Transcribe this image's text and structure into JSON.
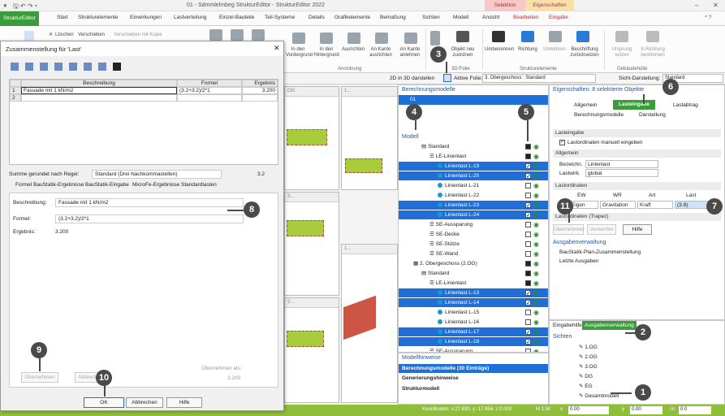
{
  "app": {
    "title": "01 - Sdmmlelmbeg StrukturEditor - StrukturEditor 2022",
    "context_selection": "Selektion",
    "context_properties": "Eigenschaften"
  },
  "tabs": [
    "StrukturEditor",
    "Start",
    "Strukturelemente",
    "Einwirkungen",
    "Lastverteilung",
    "Einzel-Bauteile",
    "Teil-Systeme",
    "Details",
    "Grafikelemente",
    "Bemaßung",
    "Sichten",
    "Modell",
    "Ansicht",
    "Bearbeiten",
    "Eingabe"
  ],
  "ribbon": {
    "loeschen": "Löschen",
    "verschieben": "Verschieben",
    "verschieben_kopie": "Verschieben mit Kopie",
    "in_den_vordergrund": "In den Vordergrund",
    "in_den_hintergrund": "In den Hintergrund",
    "ausrichten": "Ausrichten",
    "an_kante_ausrichten": "An Kante ausrichten",
    "an_kante_anlehnen": "An Kante anlehnen",
    "objekt_neu_zuordnen": "Objekt neu zuordnen",
    "umbenennen": "Umbenennen",
    "richtung": "Richtung",
    "umkehren": "Umkehren",
    "beschriftung_zurucksetzen": "Beschriftung zurücksetzen",
    "ursprung_setzen": "Ursprung setzen",
    "x_richtung_bestimmen": "X-Richtung bestimmen",
    "group_anordnung": "Anordnung",
    "group_3dfolie": "3D-Folie",
    "group_strukturelemente": "Strukturelemente",
    "group_gebaeudehuelle": "Gebäudehülle"
  },
  "optbar": {
    "label_2d3d": "2D in 3D darstellen",
    "label_aktive_folie": "Aktive Folie:",
    "aktive_folie": "3. Obergeschoss : Standard",
    "label_sicht": "Sicht-Darstellung:",
    "sicht": "Standard"
  },
  "views": {
    "v1": "OG",
    "v2": "1...",
    "v3": "3...",
    "v4": "1...",
    "v5": "3..."
  },
  "berechnungsmodelle": {
    "header": "Berechnungsmodelle",
    "item": "01",
    "modell_label": "Modell",
    "rows": [
      {
        "label": "Standard",
        "level": 2,
        "icon": "folder",
        "sel": false,
        "ck": "box"
      },
      {
        "label": "LE-Linienlast",
        "level": 3,
        "icon": "list",
        "sel": false,
        "ck": "box"
      },
      {
        "label": "Linienlast L-19",
        "level": 4,
        "icon": "dot",
        "sel": true,
        "ck": "on"
      },
      {
        "label": "Linienlast L-20",
        "level": 4,
        "icon": "dot",
        "sel": true,
        "ck": "on"
      },
      {
        "label": "Linienlast L-21",
        "level": 4,
        "icon": "dot",
        "sel": false,
        "ck": "off"
      },
      {
        "label": "Linienlast L-22",
        "level": 4,
        "icon": "dot",
        "sel": false,
        "ck": "off"
      },
      {
        "label": "Linienlast L-23",
        "level": 4,
        "icon": "dot",
        "sel": true,
        "ck": "on"
      },
      {
        "label": "Linienlast L-24",
        "level": 4,
        "icon": "dot",
        "sel": true,
        "ck": "on"
      },
      {
        "label": "SE-Aussparung",
        "level": 3,
        "icon": "list",
        "sel": false,
        "ck": "off"
      },
      {
        "label": "SE-Decke",
        "level": 3,
        "icon": "list",
        "sel": false,
        "ck": "off"
      },
      {
        "label": "SE-Stütze",
        "level": 3,
        "icon": "list",
        "sel": false,
        "ck": "off"
      },
      {
        "label": "SE-Wand",
        "level": 3,
        "icon": "list",
        "sel": false,
        "ck": "off"
      },
      {
        "label": "2. Obergeschoss (2.OG)",
        "level": 1,
        "icon": "floor",
        "sel": false,
        "ck": "box"
      },
      {
        "label": "Standard",
        "level": 2,
        "icon": "folder",
        "sel": false,
        "ck": "box"
      },
      {
        "label": "LE-Linienlast",
        "level": 3,
        "icon": "list",
        "sel": false,
        "ck": "box"
      },
      {
        "label": "Linienlast L-13",
        "level": 4,
        "icon": "dot",
        "sel": true,
        "ck": "on"
      },
      {
        "label": "Linienlast L-14",
        "level": 4,
        "icon": "dot",
        "sel": true,
        "ck": "on"
      },
      {
        "label": "Linienlast L-15",
        "level": 4,
        "icon": "dot",
        "sel": false,
        "ck": "off"
      },
      {
        "label": "Linienlast L-16",
        "level": 4,
        "icon": "dot",
        "sel": false,
        "ck": "off"
      },
      {
        "label": "Linienlast L-17",
        "level": 4,
        "icon": "dot",
        "sel": true,
        "ck": "on"
      },
      {
        "label": "Linienlast L-18",
        "level": 4,
        "icon": "dot",
        "sel": true,
        "ck": "on"
      },
      {
        "label": "SE-Aussparung",
        "level": 3,
        "icon": "list",
        "sel": false,
        "ck": "off"
      }
    ]
  },
  "hinweise": {
    "header": "Modellhinweise",
    "row1": "Berechnungsmodelle (30 Einträge)",
    "row2": "Generierungshinweise",
    "row3": "Strukturmodell"
  },
  "properties": {
    "header": "Eigenschaften: 8 selektierte Objekte",
    "tab_allgemein": "Allgemein",
    "tab_lasteingabe": "Lasteingabe",
    "tab_lastabtrag": "Lastabtrag",
    "tab_berechnungsmodelle": "Berechnungsmodelle",
    "tab_darstellung": "Darstellung",
    "sect_lasteingabe": "Lasteingabe",
    "chk_manuell": "Lastordinaten manuell eingeben",
    "sect_allgemein": "Allgemein",
    "lbl_bezeichn": "Bezeichn.",
    "val_bezeichn": "Linienlast",
    "lbl_lastwirk": "Lastwirk.",
    "val_lastwirk": "global",
    "sect_lastordinaten": "Lastordinaten",
    "col_ew": "EW",
    "col_wr": "WR",
    "col_art": "Art",
    "col_last": "Last",
    "val_ew": "Eigen",
    "val_wr": "Gravitation",
    "val_art": "Kraft",
    "val_last": "(3.8)",
    "sect_trapez": "Lastordinaten (Trapez)",
    "btn_uebernehmen": "Übernehmen",
    "btn_verwerfen": "Verwerfen",
    "btn_hilfe": "Hilfe"
  },
  "ausgaben": {
    "header": "Ausgabenverwaltung",
    "item1": "BauStatik-Plan-Zusammenstellung",
    "item2": "Letzte Ausgaben"
  },
  "sichten": {
    "tab_eingabehilfe": "Eingabehilfe",
    "tab_ausgaben": "Ausgabenverwaltung",
    "header": "Sichten",
    "items": [
      "1.OG",
      "2.OG",
      "3.OG",
      "DG",
      "EG",
      "Gesamtmodell"
    ]
  },
  "statusbar": {
    "koordinaten": "Koordinaten: x:27.630, y:-17.956, z:0.000",
    "massstab": "M 1:50",
    "lbl_x": "x",
    "val_x": "0.00",
    "lbl_y": "y",
    "val_y": "0.00",
    "lbl_m": "m",
    "val_m": "0.0"
  },
  "dialog": {
    "title": "Zusammenstellung für 'Last'",
    "col_num": "",
    "col_beschreibung": "Beschreibung",
    "col_formel": "Formel",
    "col_ergebnis": "Ergebnis",
    "row1": {
      "n": "1",
      "beschreibung": "Fassade mit 1 kN/m2",
      "formel": "(3.2+3.2)/2*1",
      "ergebnis": "3.200"
    },
    "row2": {
      "n": "2",
      "beschreibung": "",
      "formel": "",
      "ergebnis": ""
    },
    "lbl_runden": "Summe gerundet nach Regel:",
    "val_runden": "Standard (Drei Nachkommastellen)",
    "val_summe": "3.2",
    "subtabs": [
      "Formel",
      "BauStatik-Ergebnisse",
      "BauStatik-Eingabe",
      "MicroFe-Ergebnisse",
      "Standardlasten"
    ],
    "lbl_beschreibung": "Beschreibung:",
    "val_beschreibung": "Fassade mit 1 kN/m2",
    "lbl_formel": "Formel:",
    "val_formel": "(3.2+3.2)/2*1",
    "lbl_ergebnis": "Ergebnis:",
    "val_ergebnis": "3.200",
    "btn_uebernehmen": "Übernehmen",
    "btn_abbrechen_small": "Abbrechen",
    "lbl_uebernehmen_als": "Übernehmen als:",
    "val_uebernehmen_als": "3.200",
    "btn_ok": "OK",
    "btn_abbrechen": "Abbrechen",
    "btn_hilfe": "Hilfe"
  },
  "callouts": [
    "1",
    "2",
    "3",
    "4",
    "5",
    "6",
    "7",
    "8",
    "9",
    "10",
    "11"
  ]
}
